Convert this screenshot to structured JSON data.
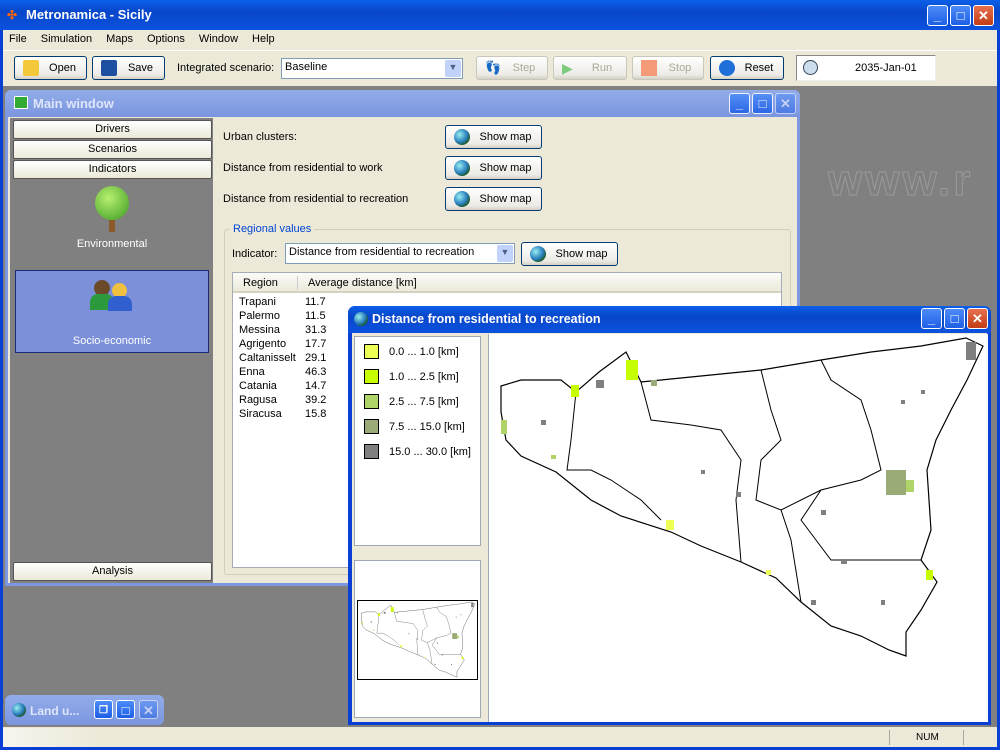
{
  "app": {
    "title": "Metronamica - Sicily",
    "watermark": "www.r"
  },
  "menu": [
    "File",
    "Simulation",
    "Maps",
    "Options",
    "Window",
    "Help"
  ],
  "toolbar": {
    "open": "Open",
    "save": "Save",
    "scenario_label": "Integrated scenario:",
    "scenario_value": "Baseline",
    "step": "Step",
    "run": "Run",
    "stop": "Stop",
    "reset": "Reset",
    "date": "2035-Jan-01"
  },
  "main_window": {
    "title": "Main window",
    "nav": {
      "drivers": "Drivers",
      "scenarios": "Scenarios",
      "indicators": "Indicators",
      "analysis": "Analysis",
      "items": [
        {
          "label": "Environmental",
          "selected": false
        },
        {
          "label": "Socio-economic",
          "selected": true
        }
      ]
    },
    "indicators": [
      {
        "label": "Urban clusters:",
        "button": "Show map"
      },
      {
        "label": "Distance from residential to work",
        "button": "Show map"
      },
      {
        "label": "Distance from residential to recreation",
        "button": "Show map"
      }
    ],
    "regional": {
      "legend": "Regional values",
      "indicator_label": "Indicator:",
      "indicator_value": "Distance from residential to recreation",
      "button": "Show map",
      "columns": [
        "Region",
        "Average distance [km]"
      ],
      "rows": [
        [
          "Trapani",
          "11.7"
        ],
        [
          "Palermo",
          "11.5"
        ],
        [
          "Messina",
          "31.3"
        ],
        [
          "Agrigento",
          "17.7"
        ],
        [
          "Caltanisselt",
          "29.1"
        ],
        [
          "Enna",
          "46.3"
        ],
        [
          "Catania",
          "14.7"
        ],
        [
          "Ragusa",
          "39.2"
        ],
        [
          "Siracusa",
          "15.8"
        ]
      ]
    }
  },
  "map_window": {
    "title": "Distance from residential to recreation",
    "legend": [
      {
        "label": "0.0 ... 1.0 [km]",
        "color": "#eeff55"
      },
      {
        "label": "1.0 ... 2.5 [km]",
        "color": "#c8ff00"
      },
      {
        "label": "2.5 ... 7.5 [km]",
        "color": "#b0d468"
      },
      {
        "label": "7.5 ... 15.0 [km]",
        "color": "#9aab78"
      },
      {
        "label": "15.0 ... 30.0 [km]",
        "color": "#7f7f7f"
      }
    ]
  },
  "minimized": {
    "title": "Land u..."
  },
  "status": {
    "num": "NUM"
  }
}
